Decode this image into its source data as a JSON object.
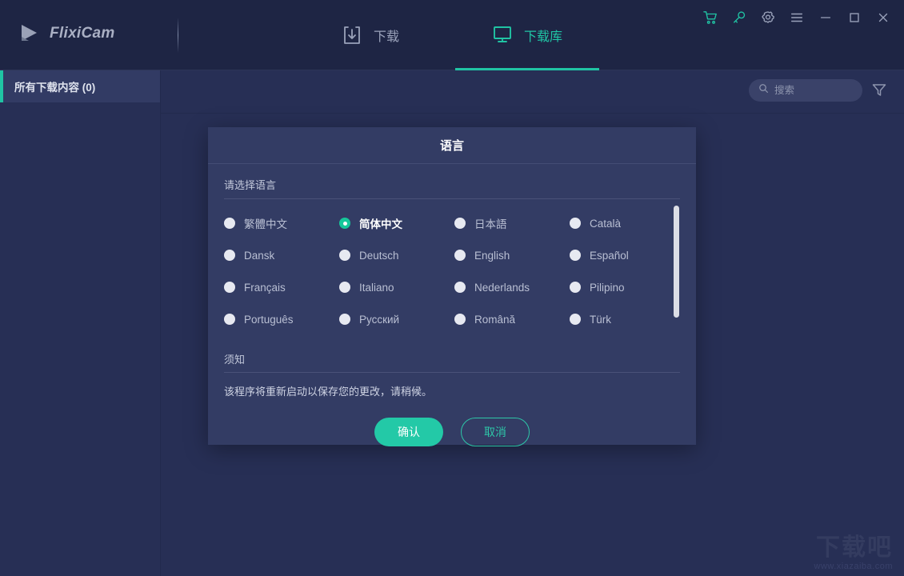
{
  "app": {
    "brand": "FlixiCam",
    "logo_icon": "play-triangle-icon"
  },
  "titlebar": {
    "tabs": [
      {
        "label": "下载",
        "icon": "download-box-icon",
        "active": false
      },
      {
        "label": "下载库",
        "icon": "monitor-icon",
        "active": true
      }
    ],
    "window_controls": [
      {
        "name": "cart-icon",
        "title": "购物车"
      },
      {
        "name": "key-icon",
        "title": "注册"
      },
      {
        "name": "gear-icon",
        "title": "设置"
      },
      {
        "name": "menu-icon",
        "title": "菜单"
      },
      {
        "name": "minimize-icon",
        "title": "最小化"
      },
      {
        "name": "maximize-icon",
        "title": "最大化"
      },
      {
        "name": "close-icon",
        "title": "关闭"
      }
    ]
  },
  "sidebar": {
    "items": [
      {
        "label": "所有下载内容 (0)",
        "active": true
      }
    ]
  },
  "content": {
    "search": {
      "value": "",
      "placeholder": "搜索",
      "icon": "search-icon"
    },
    "filter_icon": "filter-funnel-icon"
  },
  "dialog": {
    "title": "语言",
    "section_label": "请选择语言",
    "options": [
      {
        "label": "繁體中文",
        "selected": false
      },
      {
        "label": "简体中文",
        "selected": true
      },
      {
        "label": "日本語",
        "selected": false
      },
      {
        "label": "Català",
        "selected": false
      },
      {
        "label": "Dansk",
        "selected": false
      },
      {
        "label": "Deutsch",
        "selected": false
      },
      {
        "label": "English",
        "selected": false
      },
      {
        "label": "Español",
        "selected": false
      },
      {
        "label": "Français",
        "selected": false
      },
      {
        "label": "Italiano",
        "selected": false
      },
      {
        "label": "Nederlands",
        "selected": false
      },
      {
        "label": "Pilipino",
        "selected": false
      },
      {
        "label": "Português",
        "selected": false
      },
      {
        "label": "Русский",
        "selected": false
      },
      {
        "label": "Română",
        "selected": false
      },
      {
        "label": "Türk",
        "selected": false
      }
    ],
    "notice_label": "须知",
    "notice_text": "该程序将重新启动以保存您的更改，请稍候。",
    "confirm_label": "确认",
    "cancel_label": "取消"
  },
  "watermark": {
    "name": "下载吧",
    "url": "www.xiazaiba.com"
  },
  "colors": {
    "accent": "#20c4a4",
    "window_bg": "#272f55",
    "titlebar_bg": "#1e2544",
    "dialog_bg": "#333c64",
    "text_primary": "#ffffff",
    "text_muted": "#b9bfd3"
  }
}
